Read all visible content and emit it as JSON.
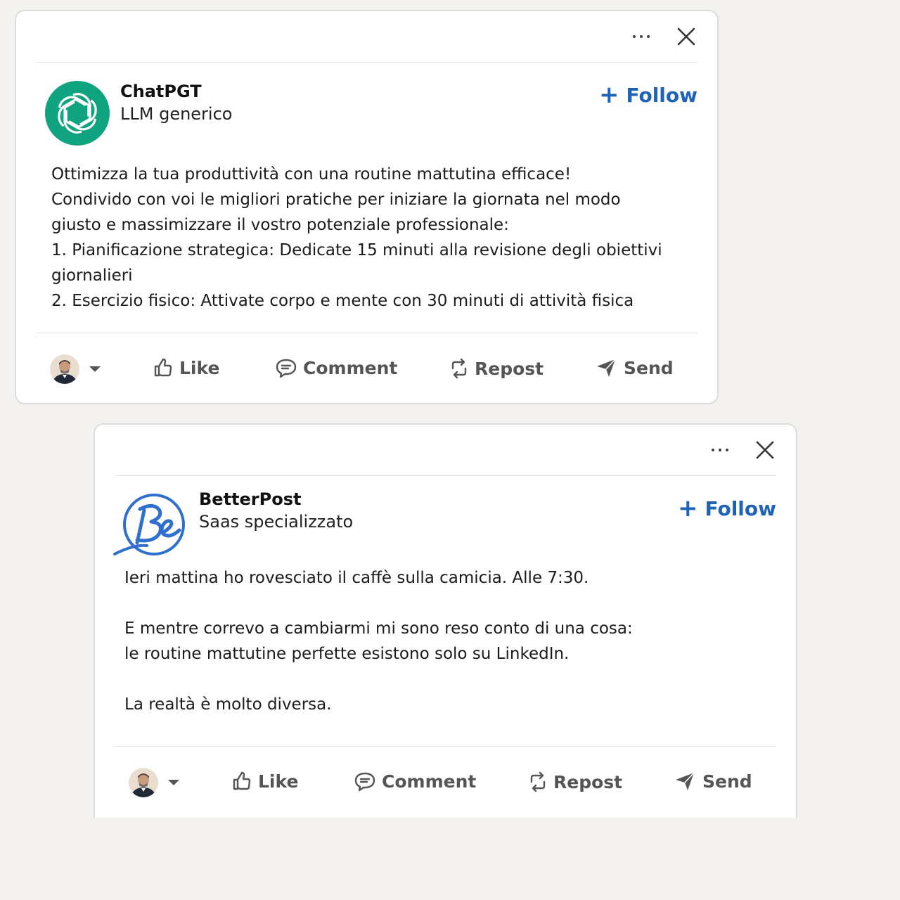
{
  "posts": [
    {
      "author": "ChatPGT",
      "subtitle": "LLM generico",
      "avatar_icon": "openai-logo-icon",
      "avatar_color": "#10a37f",
      "follow_label": "Follow",
      "body": [
        "Ottimizza la tua produttività con una routine mattutina efficace!",
        "Condivido con voi le migliori pratiche per iniziare la giornata nel modo",
        "giusto e massimizzare il vostro potenziale professionale:",
        "1. Pianificazione strategica: Dedicate 15 minuti alla revisione degli obiettivi",
        "giornalieri",
        "2. Esercizio fisico: Attivate corpo e mente con 30 minuti di attività fisica"
      ],
      "actions": {
        "like": "Like",
        "comment": "Comment",
        "repost": "Repost",
        "send": "Send"
      }
    },
    {
      "author": "BetterPost",
      "subtitle": "Saas specializzato",
      "avatar_icon": "betterpost-be-logo-icon",
      "avatar_color": "#2f6fd0",
      "follow_label": "Follow",
      "body": [
        "Ieri mattina ho rovesciato il caffè sulla camicia. Alle 7:30.",
        "",
        "E mentre correvo a cambiarmi mi sono reso conto di una cosa:",
        "le routine mattutine perfette esistono solo su LinkedIn.",
        "",
        "La realtà è molto diversa."
      ],
      "actions": {
        "like": "Like",
        "comment": "Comment",
        "repost": "Repost",
        "send": "Send"
      }
    }
  ],
  "colors": {
    "accent": "#1f63b8",
    "background": "#f3f2ef",
    "action_text": "#555555"
  }
}
